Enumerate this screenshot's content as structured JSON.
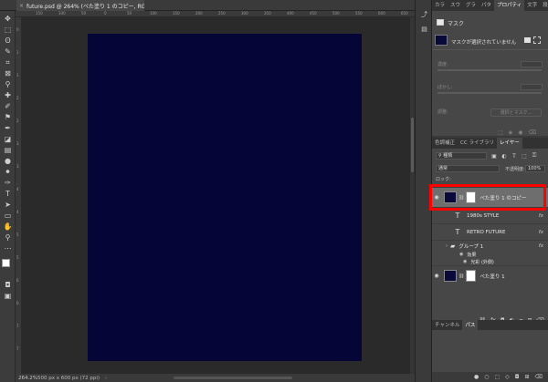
{
  "document": {
    "tab_close": "×",
    "tab_title": "future.psd @ 264% (べた塗り 1 のコピー, RGB/8) *"
  },
  "rulers": {
    "top": [
      "150",
      "100",
      "50",
      "0",
      "50",
      "100",
      "150",
      "200",
      "250",
      "300",
      "350",
      "400",
      "450",
      "500",
      "550",
      "600",
      "650",
      "700"
    ],
    "left": [
      "0",
      "1",
      "1",
      "2",
      "2",
      "3",
      "3",
      "4",
      "4",
      "5",
      "5",
      "6",
      "6",
      "7",
      "7"
    ]
  },
  "status": {
    "zoom": "264.2%",
    "dimensions": "500 px x 600 px (72 ppi)",
    "arrow": "›"
  },
  "colors": {
    "artboard": "#050538",
    "highlight": "#ff0000",
    "selected_layer": "#6e6e6e"
  },
  "properties_panel": {
    "tabs": [
      "カラ",
      "スウ",
      "グラ",
      "パタ",
      "プロパティ",
      "文字",
      "段落"
    ],
    "active_tab": "プロパティ",
    "mask_label": "マスク",
    "no_mask_selected": "マスクが選択されていません",
    "density_label": "濃度:",
    "feather_label": "ぼかし:",
    "refine_label": "調整:",
    "select_mask_button": "選択とマスク..."
  },
  "layers_panel": {
    "tabs": [
      "色調補正",
      "CC ライブラリ",
      "レイヤー"
    ],
    "active_tab": "レイヤー",
    "filter_kind": "種類",
    "blend_mode": "通常",
    "opacity_label": "不透明度:",
    "opacity_value": "100%",
    "lock_label": "ロック:",
    "layers": [
      {
        "name": "べた塗り 1 のコピー",
        "type": "fill",
        "visible": true,
        "selected": true
      },
      {
        "name": "1980s STYLE",
        "type": "text",
        "visible": false,
        "fx": "fx"
      },
      {
        "name": "RETRO FUTURE",
        "type": "text",
        "visible": false,
        "fx": "fx"
      },
      {
        "name": "グループ 1",
        "type": "group",
        "visible": false,
        "fx": "fx"
      },
      {
        "name": "効果",
        "type": "effect",
        "visible": false
      },
      {
        "name": "光彩 (外側)",
        "type": "effect",
        "visible": false
      },
      {
        "name": "べた塗り 1",
        "type": "fill",
        "visible": true
      }
    ],
    "bottom_icons": [
      "link-icon",
      "fx-icon",
      "mask-icon",
      "adjust-icon",
      "folder-icon",
      "new-layer-icon",
      "trash-icon"
    ]
  },
  "channels_panel": {
    "tabs": [
      "チャンネル",
      "パス"
    ],
    "active_tab": "パス"
  }
}
